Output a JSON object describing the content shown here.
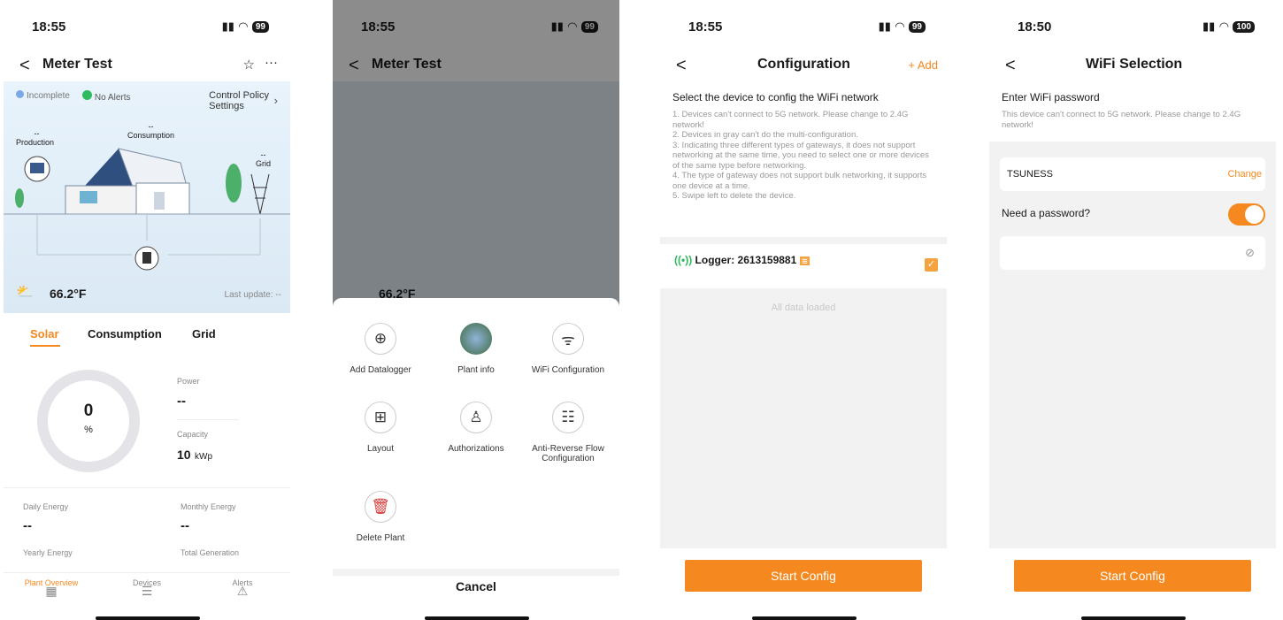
{
  "status_bars": [
    {
      "time": "18:55",
      "battery": "99"
    },
    {
      "time": "18:55",
      "battery": "99"
    },
    {
      "time": "18:55",
      "battery": "99"
    },
    {
      "time": "18:50",
      "battery": "100"
    }
  ],
  "screen1": {
    "title": "Meter Test",
    "badges": {
      "incomplete": "Incomplete",
      "alerts": "No Alerts",
      "policy": "Control Policy\nSettings"
    },
    "diagram": {
      "production_val": "--",
      "production": "Production",
      "consumption_val": "--",
      "consumption": "Consumption",
      "grid_val": "--",
      "grid": "Grid"
    },
    "weather": "66.2°F",
    "last_update": "Last update: --",
    "tabs": [
      "Solar",
      "Consumption",
      "Grid"
    ],
    "gauge": {
      "value": "0",
      "unit": "%"
    },
    "power": {
      "label": "Power",
      "value": "--"
    },
    "capacity": {
      "label": "Capacity",
      "value": "10",
      "unit": "kWp"
    },
    "stats": [
      {
        "label": "Daily Energy",
        "value": "--"
      },
      {
        "label": "Monthly Energy",
        "value": "--"
      },
      {
        "label": "Yearly Energy"
      },
      {
        "label": "Total Generation"
      }
    ],
    "tabbar": [
      "Plant Overview",
      "Devices",
      "Alerts"
    ]
  },
  "screen2": {
    "items": [
      "Add Datalogger",
      "Plant info",
      "WiFi Configuration",
      "Layout",
      "Authorizations",
      "Anti-Reverse Flow Configuration",
      "Delete Plant"
    ],
    "cancel": "Cancel"
  },
  "screen3": {
    "title": "Configuration",
    "add": "+ Add",
    "heading": "Select the device to config the WiFi network",
    "notes": [
      "1. Devices can't connect to 5G network. Please change to 2.4G network!",
      "2. Devices in gray can't do the multi-configuration.",
      "3. Indicating three different types of gateways, it does not support networking at the same time, you need to select one or more devices of the same type before networking.",
      "4. The type of gateway does not support bulk networking, it supports one device at a time.",
      "5. Swipe left to delete the device."
    ],
    "logger": "Logger: 2613159881",
    "all_loaded": "All data loaded",
    "button": "Start Config"
  },
  "screen4": {
    "title": "WiFi Selection",
    "heading": "Enter WiFi password",
    "note": "This device can't connect to 5G network. Please change to 2.4G network!",
    "ssid": "TSUNESS",
    "change": "Change",
    "need_password": "Need a password?",
    "button": "Start Config"
  },
  "colors": {
    "accent": "#f5891f"
  }
}
